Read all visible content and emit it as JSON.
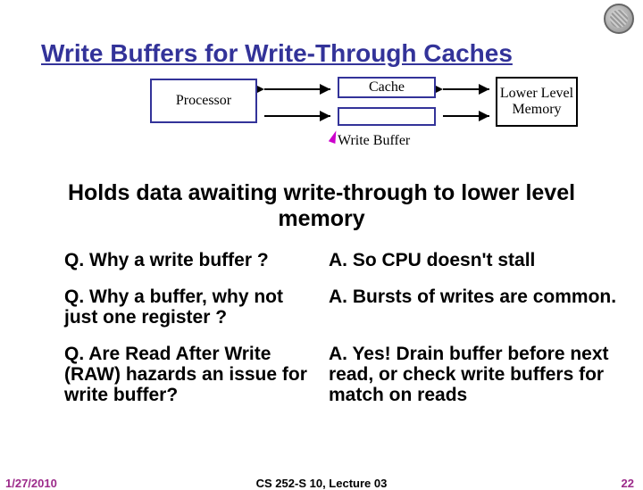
{
  "title": "Write Buffers for Write-Through Caches",
  "diagram": {
    "processor": "Processor",
    "cache": "Cache",
    "memory": "Lower Level Memory",
    "writebuffer_label": "Write Buffer"
  },
  "subtitle": "Holds data awaiting write-through to lower level memory",
  "qa": [
    {
      "q": "Q. Why a write buffer ?",
      "a": "A. So CPU doesn't stall"
    },
    {
      "q": "Q. Why a buffer, why not just one register ?",
      "a": "A. Bursts of writes are common."
    },
    {
      "q": "Q. Are Read After Write (RAW) hazards an issue for write buffer?",
      "a": "A. Yes!  Drain buffer before next read, or check write buffers for match on reads"
    }
  ],
  "footer": {
    "date": "1/27/2010",
    "course": "CS 252-S 10, Lecture 03",
    "page": "22"
  }
}
